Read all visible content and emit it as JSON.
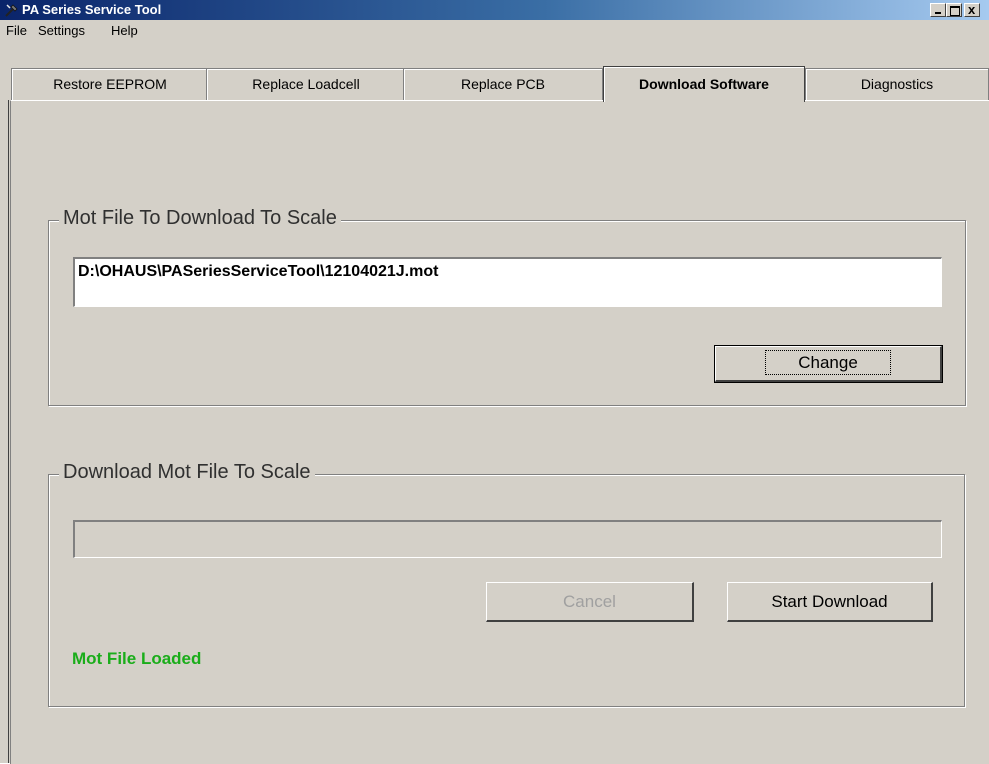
{
  "window": {
    "title": "PA Series Service Tool",
    "close_glyph": "x"
  },
  "menu": [
    "File",
    "Settings",
    "Help"
  ],
  "tabs": [
    {
      "label": "Restore EEPROM",
      "active": false
    },
    {
      "label": "Replace Loadcell",
      "active": false
    },
    {
      "label": "Replace PCB",
      "active": false
    },
    {
      "label": "Download Software",
      "active": true
    },
    {
      "label": "Diagnostics",
      "active": false
    }
  ],
  "mot_file_group": {
    "title": "Mot File To Download To Scale",
    "path": "D:\\OHAUS\\PASeriesServiceTool\\12104021J.mot",
    "change_button": "Change"
  },
  "download_group": {
    "title": "Download Mot File To Scale",
    "progress": 0,
    "cancel_button": "Cancel",
    "start_button": "Start Download",
    "status": "Mot File Loaded"
  },
  "colors": {
    "status_text": "#1aad1a",
    "title_bar": "#0a246a"
  }
}
